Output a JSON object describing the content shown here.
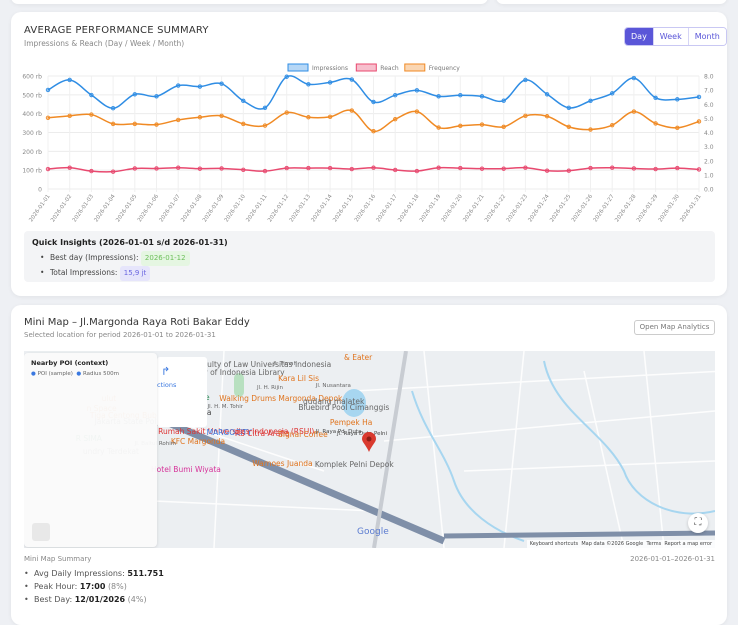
{
  "performance": {
    "title": "AVERAGE PERFORMANCE SUMMARY",
    "subtitle": "Impressions & Reach (Day / Week / Month)",
    "period_buttons": [
      {
        "label": "Day",
        "active": true
      },
      {
        "label": "Week",
        "active": false
      },
      {
        "label": "Month",
        "active": false
      }
    ],
    "insights": {
      "title": "Quick Insights (2026-01-01 s/d 2026-01-31)",
      "best_day_label": "Best day (Impressions):",
      "best_day_value": "2026-01-12",
      "total_label": "Total Impressions:",
      "total_value": "15,9 jt"
    }
  },
  "chart_data": {
    "type": "line",
    "categories": [
      "2026-01-01",
      "2026-01-02",
      "2026-01-03",
      "2026-01-04",
      "2026-01-05",
      "2026-01-06",
      "2026-01-07",
      "2026-01-08",
      "2026-01-09",
      "2026-01-10",
      "2026-01-11",
      "2026-01-12",
      "2026-01-13",
      "2026-01-14",
      "2026-01-15",
      "2026-01-16",
      "2026-01-17",
      "2026-01-18",
      "2026-01-19",
      "2026-01-20",
      "2026-01-21",
      "2026-01-22",
      "2026-01-23",
      "2026-01-24",
      "2026-01-25",
      "2026-01-26",
      "2026-01-27",
      "2026-01-28",
      "2026-01-29",
      "2026-01-30",
      "2026-01-31"
    ],
    "series": [
      {
        "name": "Impressions",
        "axis": "left",
        "unit": "thousand",
        "color": "#2f8de4",
        "values": [
          526,
          579,
          499,
          429,
          503,
          492,
          549,
          544,
          559,
          468,
          431,
          596,
          556,
          566,
          581,
          462,
          498,
          524,
          492,
          498,
          492,
          469,
          579,
          503,
          431,
          468,
          508,
          589,
          484,
          476,
          489
        ]
      },
      {
        "name": "Reach",
        "axis": "left",
        "unit": "thousand",
        "color": "#e8496f",
        "values": [
          106,
          113,
          95,
          92,
          109,
          109,
          113,
          108,
          109,
          102,
          95,
          111,
          111,
          111,
          106,
          113,
          101,
          95,
          113,
          111,
          108,
          108,
          113,
          97,
          97,
          111,
          113,
          109,
          106,
          111,
          104
        ]
      },
      {
        "name": "Frequency",
        "axis": "right",
        "color": "#f08a24",
        "values": [
          5.04,
          5.18,
          5.27,
          4.61,
          4.61,
          4.56,
          4.89,
          5.08,
          5.18,
          4.61,
          4.49,
          5.41,
          5.08,
          5.11,
          5.55,
          4.09,
          4.94,
          5.48,
          4.35,
          4.47,
          4.56,
          4.4,
          5.18,
          5.15,
          4.4,
          4.21,
          4.52,
          5.48,
          4.64,
          4.33,
          4.78
        ]
      }
    ],
    "y_left": {
      "ylim": [
        0,
        600
      ],
      "ticks": [
        "0",
        "100 rb",
        "200 rb",
        "300 rb",
        "400 rb",
        "500 rb",
        "600 rb"
      ]
    },
    "y_right": {
      "ylim": [
        0,
        8
      ],
      "ticks": [
        "0.0",
        "1.0",
        "2.0",
        "3.0",
        "4.0",
        "5.0",
        "6.0",
        "7.0",
        "8.0"
      ]
    },
    "grid": true,
    "legend": "top-center"
  },
  "minimap": {
    "title": "Mini Map – Jl.Margonda Raya Roti Bakar Eddy",
    "subtitle": "Selected location for period 2026-01-01 to 2026-01-31",
    "open_button": "Open Map Analytics",
    "poi_panel": {
      "title": "Nearby POI (context)",
      "legend": [
        "POI (sample)",
        "Radius 500m"
      ]
    },
    "directions_text": "ctions",
    "map_labels": [
      {
        "text": "Faculty of Law Universitas Indonesia",
        "color": "#666"
      },
      {
        "text": "University of Indonesia Library",
        "color": "#666"
      },
      {
        "text": "Kenanga Lake",
        "color": "#2e8b57"
      },
      {
        "text": "Walking Drums Margonda Depok",
        "color": "#e0741e"
      },
      {
        "text": "Kara Lil Sis",
        "color": "#e0741e"
      },
      {
        "text": "gudang malatek",
        "color": "#666"
      },
      {
        "text": "Bluebird Pool Cimanggis",
        "color": "#666"
      },
      {
        "text": "Pondok Cina",
        "color": "#444"
      },
      {
        "text": "Tiga Centong Bubur",
        "color": "#e0741e"
      },
      {
        "text": "n Space",
        "color": "#e0741e"
      },
      {
        "text": "Jakarta State Polytechnic",
        "color": "#666"
      },
      {
        "text": "Rumah Sakit Universitas Indonesia (RSUI)",
        "color": "#d33"
      },
      {
        "text": "MARGOCITY",
        "color": "#3a78e0"
      },
      {
        "text": "RS Citra Arafiq",
        "color": "#d33"
      },
      {
        "text": "Signal Coffee",
        "color": "#e0741e"
      },
      {
        "text": "Jl. Raya Pd. Duta",
        "color": "#444"
      },
      {
        "text": "Jl. Raya Duta Pelni",
        "color": "#444"
      },
      {
        "text": "Pempek Ha",
        "color": "#e0741e"
      },
      {
        "text": "KFC Margonda",
        "color": "#e0741e"
      },
      {
        "text": "R SIMA",
        "color": "#2e8b57"
      },
      {
        "text": "undry Terdekat",
        "color": "#666"
      },
      {
        "text": "Warnoes Juanda",
        "color": "#e0741e"
      },
      {
        "text": "Komplek Pelni Depok",
        "color": "#666"
      },
      {
        "text": "Hotel Bumi Wiyata",
        "color": "#d6339a"
      },
      {
        "text": "Jl. H. M. Tohir",
        "color": "#666"
      },
      {
        "text": "Jl. H. Rijin",
        "color": "#666"
      },
      {
        "text": "Jl. Nusantara",
        "color": "#666"
      },
      {
        "text": "Jl. Baitul Rohim",
        "color": "#666"
      },
      {
        "text": "Jl. Timah",
        "color": "#666"
      },
      {
        "text": "& Eater",
        "color": "#e0741e"
      },
      {
        "text": "ulut",
        "color": "#e0741e"
      }
    ],
    "attribution": [
      "Keyboard shortcuts",
      "Map data ©2026 Google",
      "Terms",
      "Report a map error"
    ],
    "google_logo": "Google",
    "summary": {
      "label": "Mini Map Summary",
      "range": "2026-01-01–2026-01-31",
      "avg_label": "Avg Daily Impressions:",
      "avg_value": "511.751",
      "peak_label": "Peak Hour:",
      "peak_value": "17:00",
      "peak_pct": "(8%)",
      "best_label": "Best Day:",
      "best_value": "12/01/2026",
      "best_pct": "(4%)"
    }
  }
}
